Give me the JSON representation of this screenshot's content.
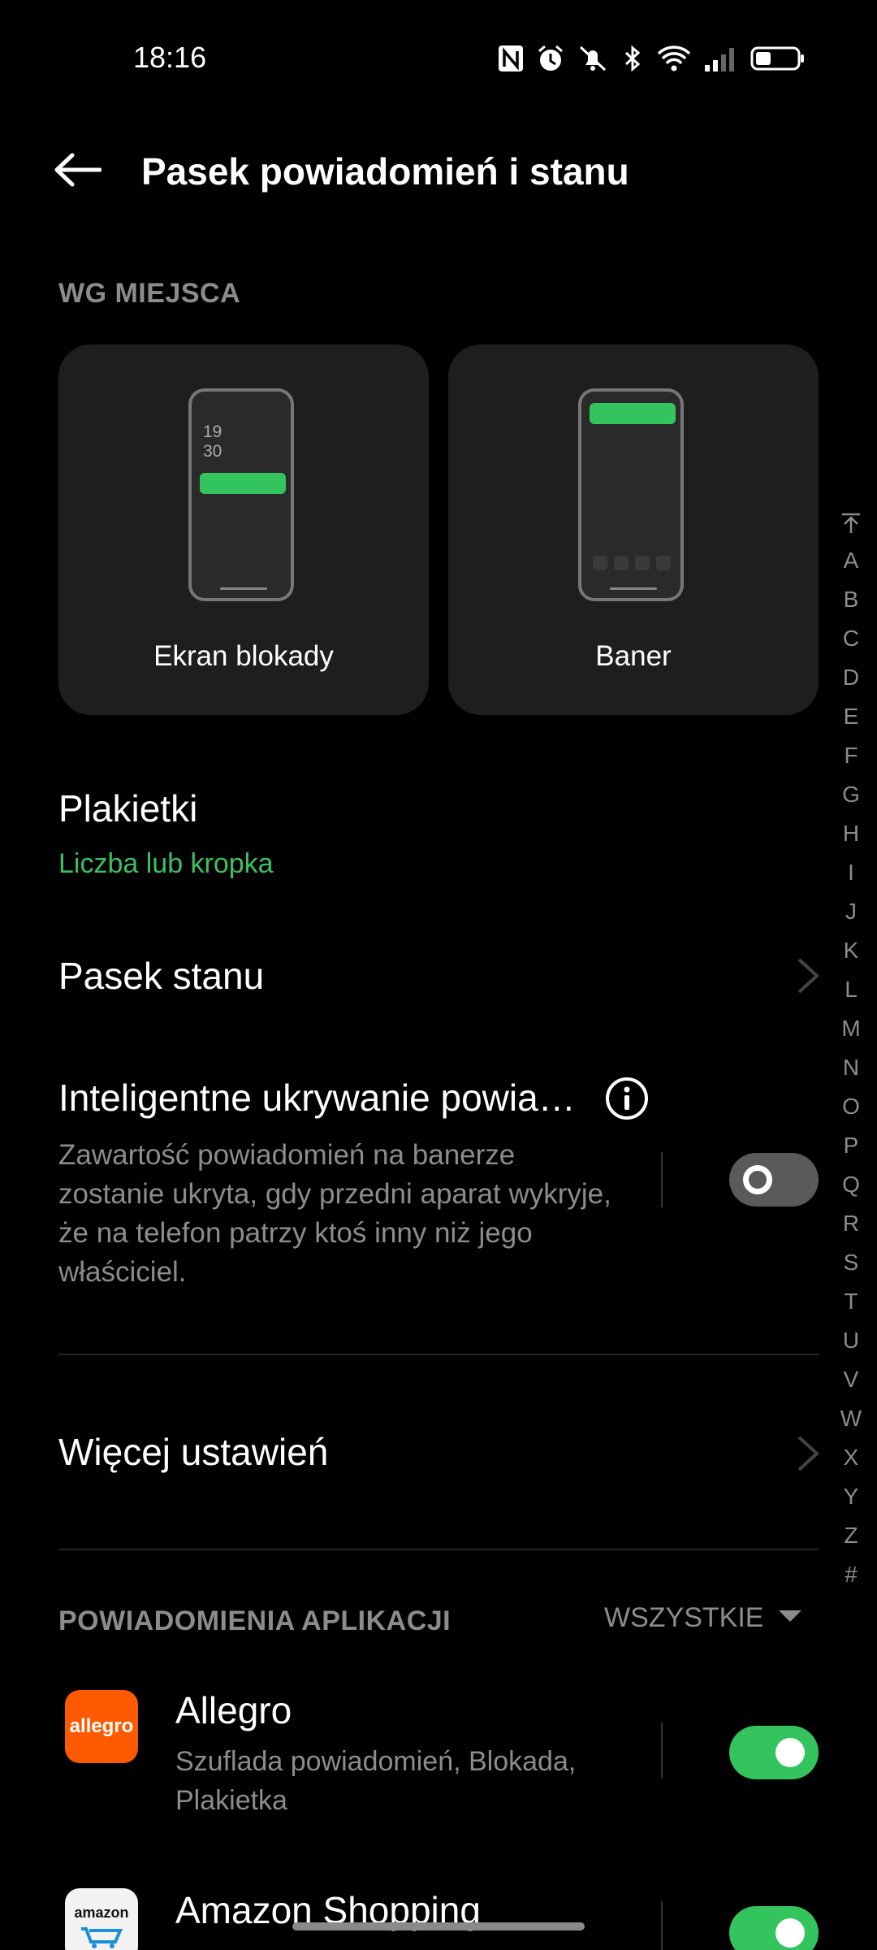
{
  "status_bar": {
    "time": "18:16",
    "icons": [
      "nfc-icon",
      "alarm-icon",
      "mute-icon",
      "bluetooth-icon",
      "wifi-icon",
      "signal-icon",
      "battery-icon"
    ]
  },
  "header": {
    "title": "Pasek powiadomień i stanu",
    "back_icon": "back-arrow-icon"
  },
  "location_section": {
    "header": "WG MIEJSCA",
    "cards": [
      {
        "label": "Ekran blokady",
        "preview_clock": [
          "19",
          "30"
        ]
      },
      {
        "label": "Baner"
      }
    ]
  },
  "badges": {
    "title": "Plakietki",
    "value": "Liczba lub kropka"
  },
  "status_bar_row": {
    "title": "Pasek stanu"
  },
  "smart_hide": {
    "title": "Inteligentne ukrywanie powia…",
    "description": "Zawartość powiadomień na banerze zostanie ukryta, gdy przedni aparat wykryje, że na telefon patrzy ktoś inny niż jego właściciel.",
    "enabled": false
  },
  "more_settings": {
    "title": "Więcej ustawień"
  },
  "app_notifications": {
    "header": "POWIADOMIENIA APLIKACJI",
    "filter": "WSZYSTKIE",
    "apps": [
      {
        "name": "Allegro",
        "icon_text": "allegro",
        "subtitle": "Szuflada powiadomień, Blokada, Plakietka",
        "enabled": true
      },
      {
        "name": "Amazon Shopping",
        "icon_text": "amazon",
        "enabled": true
      }
    ]
  },
  "alphabet_index": [
    "A",
    "B",
    "C",
    "D",
    "E",
    "F",
    "G",
    "H",
    "I",
    "J",
    "K",
    "L",
    "M",
    "N",
    "O",
    "P",
    "Q",
    "R",
    "S",
    "T",
    "U",
    "V",
    "W",
    "X",
    "Y",
    "Z",
    "#"
  ],
  "colors": {
    "accent": "#33c45d",
    "background": "#000000",
    "card": "#1e1e1e",
    "secondary_text": "#8c8c8c",
    "allegro_brand": "#ff5a00"
  }
}
